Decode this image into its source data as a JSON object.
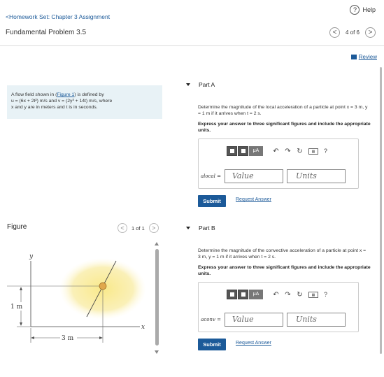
{
  "header": {
    "back_link": "<Homework Set: Chapter 3 Assignment",
    "help": "Help",
    "problem_title": "Fundamental Problem 3.5",
    "pager_text": "4 of 6",
    "prev": "<",
    "next": ">"
  },
  "review": {
    "label": "Review"
  },
  "problem": {
    "line1_pre": "A flow field shown in (",
    "line1_link": "Figure 1",
    "line1_post": ") is defined by",
    "line2": "u = (6x + 2t²) m/s and v = (2y³ + 14t) m/s, where",
    "line3": "x and y are in meters and t is in seconds."
  },
  "figure": {
    "label": "Figure",
    "pager_text": "1 of 1",
    "prev": "<",
    "next": ">",
    "axis_y": "y",
    "axis_x": "x",
    "dim_y": "1 m",
    "dim_x": "3 m"
  },
  "partA": {
    "title": "Part A",
    "question": "Determine the magnitude of the local acceleration of a particle at point x = 3 m, y = 1 m if it arrives when t = 2 s.",
    "instruction": "Express your answer to three significant figures and include the appropriate units.",
    "var_label": "alocal =",
    "value_placeholder": "Value",
    "units_placeholder": "Units",
    "submit": "Submit",
    "request": "Request Answer",
    "mu": "μA",
    "help_q": "?"
  },
  "partB": {
    "title": "Part B",
    "question": "Determine the magnitude of the convective acceleration of a particle at point x = 3 m, y = 1 m if it arrives when t = 2 s.",
    "instruction": "Express your answer to three significant figures and include the appropriate units.",
    "var_label": "aconv =",
    "value_placeholder": "Value",
    "units_placeholder": "Units",
    "submit": "Submit",
    "request": "Request Answer",
    "mu": "μA",
    "help_q": "?"
  },
  "toolbar_icons": [
    "template-icon",
    "matrix-icon",
    "mu-units-icon",
    "undo-icon",
    "redo-icon",
    "reset-icon",
    "keyboard-icon",
    "help-icon"
  ],
  "colors": {
    "accent": "#1c5a99",
    "problem_bg": "#e8f2f6",
    "glow": "#f6e27a",
    "particle": "#e0a84c"
  }
}
